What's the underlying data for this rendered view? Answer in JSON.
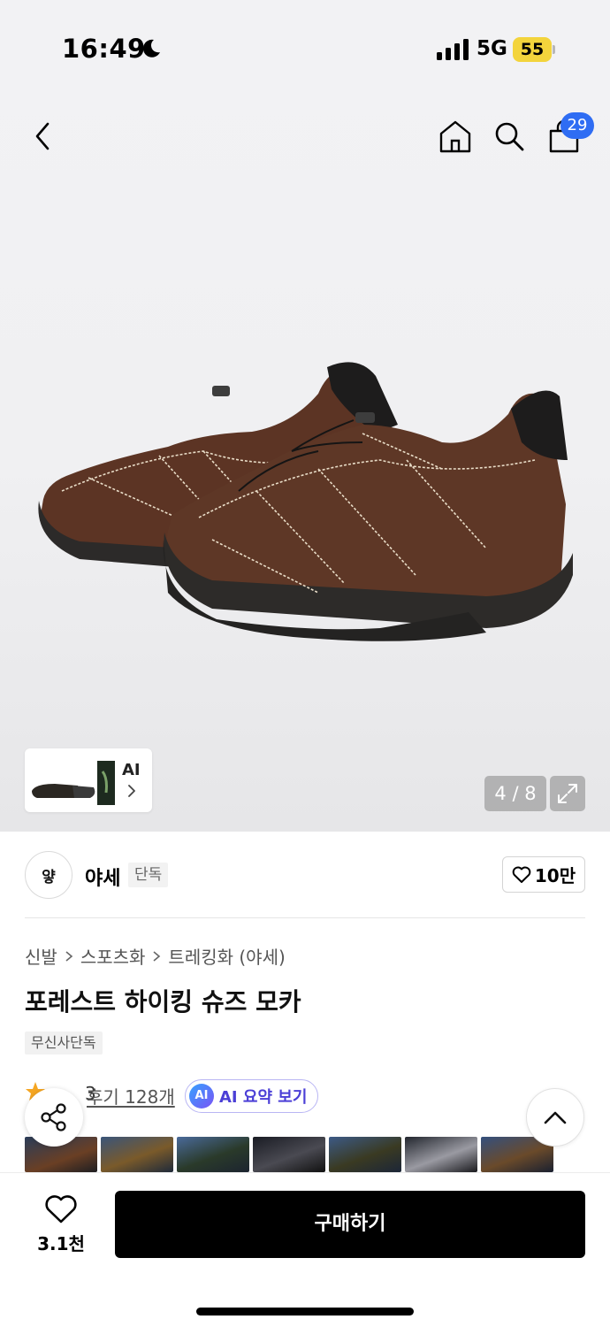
{
  "status_bar": {
    "time": "16:49",
    "network": "5G",
    "battery": "55"
  },
  "nav": {
    "cart_count": "29"
  },
  "gallery": {
    "counter": "4 / 8",
    "thumb_label": "AI"
  },
  "brand": {
    "logo_text": "얗",
    "name": "야세",
    "tag": "단독",
    "likes": "10만"
  },
  "breadcrumb": [
    "신발",
    "스포츠화",
    "트레킹화 (야세)"
  ],
  "product": {
    "title": "포레스트 하이킹 슈즈 모카",
    "tag": "무신사단독"
  },
  "reviews": {
    "rating": "3",
    "review_link": "후기 128개",
    "ai_summary": "AI 요약 보기",
    "ai_badge": "AI"
  },
  "bottom": {
    "wish_count": "3.1천",
    "buy_label": "구매하기"
  },
  "colors": {
    "accent_blue": "#2f6df3",
    "buy_button": "#000000",
    "battery": "#f3d43c",
    "ai_text": "#4b3fd6"
  }
}
